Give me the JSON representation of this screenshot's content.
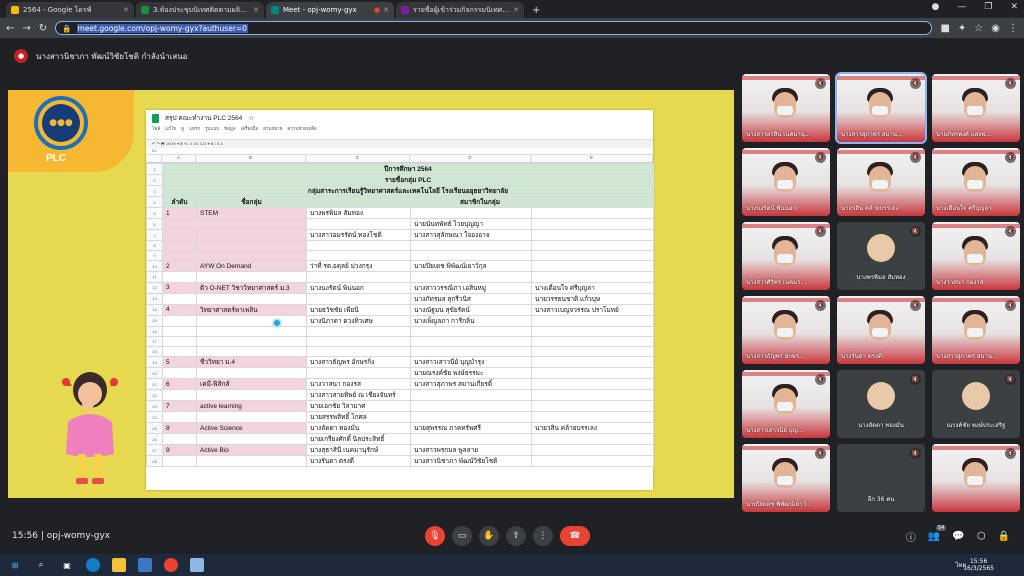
{
  "browser": {
    "tabs": [
      {
        "title": "2564 - Google ไดรฟ์",
        "color": "#4285f4"
      },
      {
        "title": "3.ห้องประชุมนิเทศติดตามผลิตสื่อการ...",
        "color": "#1e8e3e"
      },
      {
        "title": "Meet - opj-womy-gyx",
        "color": "#00897b"
      },
      {
        "title": "รายชื่อผู้เข้าร่วมกิจกรรมนิเทศติดตามผล...",
        "color": "#7b1fa2"
      }
    ],
    "new_tab": "+",
    "url": "meet.google.com/opj-womy-gyx?authuser=0",
    "url_prefix": "🔒"
  },
  "meet": {
    "presenter_text": "นางสาวนิชาภา พัฒน์วิชัยโชติ กำลังนำเสนอ",
    "meeting_time": "15:56",
    "meeting_code": "opj-womy-gyx",
    "people_count": "54",
    "more_count": "อีก 36 คน"
  },
  "slide": {
    "logo_label": "PLC",
    "sheet_title": "สรุป คณะทำงาน PLC 2564",
    "sheet_menu": [
      "ไฟล์",
      "แก้ไข",
      "ดู",
      "แทรก",
      "รูปแบบ",
      "ข้อมูล",
      "เครื่องมือ",
      "ส่วนขยาย",
      "ความช่วยเหลือ"
    ],
    "cell_ref": "B2",
    "col_headers": [
      "A",
      "B",
      "C",
      "D",
      "E"
    ],
    "year": "ปีการศึกษา 2564",
    "list_title": "รายชื่อกลุ่ม PLC",
    "dept": "กลุ่มสาระการเรียนรู้วิทยาศาสตร์และเทคโนโลยี โรงเรียนอยุธยาวิทยาลัย",
    "h_no": "ลำดับ",
    "h_group": "ชื่อกลุ่ม",
    "h_members": "สมาชิกในกลุ่ม",
    "rows": [
      {
        "rn": "5",
        "no": "1",
        "g": "STEM",
        "c": "นางพรพิมล สัมทอง",
        "d": "",
        "e": ""
      },
      {
        "rn": "6",
        "no": "",
        "g": "",
        "c": "",
        "d": "นายนันทพัทธ์ ไวยบุญญา",
        "e": ""
      },
      {
        "rn": "7",
        "no": "",
        "g": "",
        "c": "นางสาวอมรรัตน์ ทองโชติ",
        "d": "นางสาวสุลักษณา ใจองอาจ",
        "e": ""
      },
      {
        "rn": "8",
        "no": "",
        "g": "",
        "c": "",
        "d": "",
        "e": ""
      },
      {
        "rn": "9",
        "no": "",
        "g": "",
        "c": "",
        "d": "",
        "e": ""
      },
      {
        "rn": "10",
        "no": "2",
        "g": "AYW On Demand",
        "c": "ว่าที่ รต.อดุลย์ ม่วงกรุง",
        "d": "นายปิยเดช พิพัฒน์เยาว์กุล",
        "e": ""
      },
      {
        "rn": "11",
        "no": "",
        "g": "",
        "c": "",
        "d": "",
        "e": ""
      },
      {
        "rn": "12",
        "no": "3",
        "g": "ติว O-NET วิชาวิทยาศาสตร์ ม.3",
        "c": "นางนงรัตน์ พินนอก",
        "d": "นางสาววรรณิภา เอสินหมู่",
        "e": "นางเตือนใจ ศรีบุญลา"
      },
      {
        "rn": "13",
        "no": "",
        "g": "",
        "c": "",
        "d": "นางภัทรมล สุกรีวนิส",
        "e": "นายวรรธนชาติ แก้วบุษ"
      },
      {
        "rn": "14",
        "no": "4",
        "g": "วิทยาศาสตร์พาเพลิน",
        "c": "นายธวัชชัย เพียนิ",
        "d": "นางณัฐมน สุขัยรัตน์",
        "e": "นางสาวเบญจวรรณ ปราโมทย์"
      },
      {
        "rn": "15",
        "no": "",
        "g": "",
        "c": "นางนิภาดา ดวงทิวเศษ",
        "d": "นางเพ็ญลภา การีกลิ่น",
        "e": ""
      },
      {
        "rn": "16",
        "no": "",
        "g": "",
        "c": "",
        "d": "",
        "e": ""
      },
      {
        "rn": "17",
        "no": "",
        "g": "",
        "c": "",
        "d": "",
        "e": ""
      },
      {
        "rn": "18",
        "no": "",
        "g": "",
        "c": "",
        "d": "",
        "e": ""
      },
      {
        "rn": "19",
        "no": "5",
        "g": "ชีววิทยา ม.4",
        "c": "นางสาวธัญพร อักษรกิ่ง",
        "d": "นางสาวเสาวนีย์ บุญบำรุง",
        "e": ""
      },
      {
        "rn": "20",
        "no": "",
        "g": "",
        "c": "",
        "d": "นายณรงค์ชัย พงษ์ธรรมะ",
        "e": ""
      },
      {
        "rn": "21",
        "no": "6",
        "g": "เคมี-ฟิสิกส์",
        "c": "นางวาสนา กองรส",
        "d": "นางสาวสุภาพร สมานเกียรติ์",
        "e": ""
      },
      {
        "rn": "22",
        "no": "",
        "g": "",
        "c": "นางสาวสายทิพย์ ณ เชียงจันทร์",
        "d": "",
        "e": ""
      },
      {
        "rn": "23",
        "no": "7",
        "g": "active learning",
        "c": "นายเอกชัย วิลามาศ",
        "d": "",
        "e": ""
      },
      {
        "rn": "24",
        "no": "",
        "g": "",
        "c": "นายสรรพสิทธิ์ โกศล",
        "d": "",
        "e": ""
      },
      {
        "rn": "25",
        "no": "8",
        "g": "Active Science",
        "c": "นางลัดดา ทองมั่น",
        "d": "นายสุพรรณ ภาคทรัพศรี",
        "e": "นายวสิน คล้ายบรรเลง"
      },
      {
        "rn": "26",
        "no": "",
        "g": "",
        "c": "นายเกรียงศักดิ์ นิลประสิทธิ์",
        "d": "",
        "e": ""
      },
      {
        "rn": "27",
        "no": "9",
        "g": "Active Bio",
        "c": "นางสุธาสินี เนคมานุรักษ์",
        "d": "นางสาวพรกมล พูลลาย",
        "e": ""
      },
      {
        "rn": "28",
        "no": "",
        "g": "",
        "c": "นางรันดา ตรงดี",
        "d": "นางสาวนิชาภา พัฒน์วิชัยโชติ",
        "e": ""
      }
    ]
  },
  "participants": [
    {
      "name": "นางสาวอรสิน เนคมานุ...",
      "type": "cam",
      "col": 0,
      "row": 0
    },
    {
      "name": "นางสาวสุภาพร สมาน...",
      "type": "cam",
      "col": 1,
      "row": 0,
      "active": true
    },
    {
      "name": "นายภัทรพงศ์ แสงพ...",
      "type": "cam",
      "col": 2,
      "row": 0
    },
    {
      "name": "นางนงรัตน์ พินนอก",
      "type": "cam",
      "col": 0,
      "row": 1
    },
    {
      "name": "นายวสิน คล้ายบรรเลง",
      "type": "cam",
      "col": 1,
      "row": 1
    },
    {
      "name": "นางเตือนใจ ศรีบุญลา",
      "type": "cam",
      "col": 2,
      "row": 1
    },
    {
      "name": "นางสาวศิริพร เนคมา...",
      "type": "cam",
      "col": 0,
      "row": 2
    },
    {
      "name": "นางพรพิมล สัมทอง",
      "type": "dark",
      "col": 1,
      "row": 2
    },
    {
      "name": "นางวาสนา กองรส",
      "type": "cam",
      "col": 2,
      "row": 2
    },
    {
      "name": "นางสาวธัญพร อักษร...",
      "type": "cam",
      "col": 0,
      "row": 3
    },
    {
      "name": "นางรันดา ตรงดี",
      "type": "cam",
      "col": 1,
      "row": 3
    },
    {
      "name": "นางสาวสุภาพร สมาน...",
      "type": "cam",
      "col": 2,
      "row": 3
    },
    {
      "name": "นางสาวเสาวนีย์ บุญ...",
      "type": "cam",
      "col": 0,
      "row": 4
    },
    {
      "name": "นางลัดดา ทองมั่น",
      "type": "dark",
      "col": 1,
      "row": 4
    },
    {
      "name": "ณรงค์ชัย พงษ์ประเสริฐ",
      "type": "dark",
      "col": 2,
      "row": 4
    },
    {
      "name": "นายปิยเดช พิพัฒน์เยาว์...",
      "type": "cam",
      "col": 0,
      "row": 5
    },
    {
      "name": "อีก 36 คน",
      "type": "dark",
      "col": 1,
      "row": 5
    },
    {
      "name": "",
      "type": "cam",
      "col": 2,
      "row": 5
    }
  ],
  "taskbar": {
    "time": "15:56",
    "date": "16/3/2565",
    "lang": "ไทย"
  }
}
